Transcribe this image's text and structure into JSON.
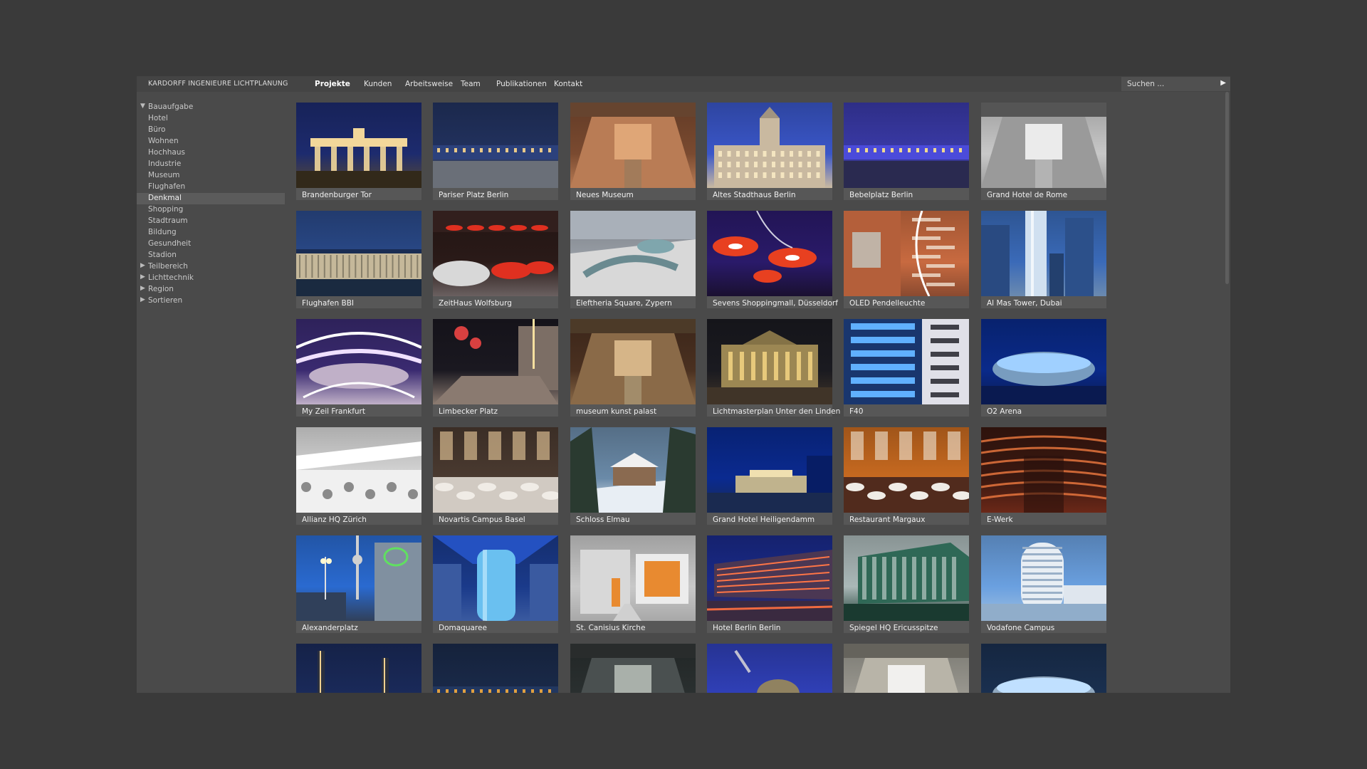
{
  "brand": "KARDORFF INGENIEURE LICHTPLANUNG",
  "nav": [
    "Projekte",
    "Kunden",
    "Arbeitsweise",
    "Team",
    "Publikationen",
    "Kontakt"
  ],
  "nav_active": "Projekte",
  "search": {
    "placeholder": "Suchen ...",
    "go": "▶"
  },
  "sidebar": [
    {
      "label": "Bauaufgabe",
      "tri": "▼",
      "sub": false,
      "sel": false
    },
    {
      "label": "Hotel",
      "tri": "",
      "sub": true,
      "sel": false
    },
    {
      "label": "Büro",
      "tri": "",
      "sub": true,
      "sel": false
    },
    {
      "label": "Wohnen",
      "tri": "",
      "sub": true,
      "sel": false
    },
    {
      "label": "Hochhaus",
      "tri": "",
      "sub": true,
      "sel": false
    },
    {
      "label": "Industrie",
      "tri": "",
      "sub": true,
      "sel": false
    },
    {
      "label": "Museum",
      "tri": "",
      "sub": true,
      "sel": false
    },
    {
      "label": "Flughafen",
      "tri": "",
      "sub": true,
      "sel": false
    },
    {
      "label": "Denkmal",
      "tri": "",
      "sub": true,
      "sel": true
    },
    {
      "label": "Shopping",
      "tri": "",
      "sub": true,
      "sel": false
    },
    {
      "label": "Stadtraum",
      "tri": "",
      "sub": true,
      "sel": false
    },
    {
      "label": "Bildung",
      "tri": "",
      "sub": true,
      "sel": false
    },
    {
      "label": "Gesundheit",
      "tri": "",
      "sub": true,
      "sel": false
    },
    {
      "label": "Stadion",
      "tri": "",
      "sub": true,
      "sel": false
    },
    {
      "label": "Teilbereich",
      "tri": "▶",
      "sub": false,
      "sel": false
    },
    {
      "label": "Lichttechnik",
      "tri": "▶",
      "sub": false,
      "sel": false
    },
    {
      "label": "Region",
      "tri": "▶",
      "sub": false,
      "sel": false
    },
    {
      "label": "Sortieren",
      "tri": "▶",
      "sub": false,
      "sel": false
    }
  ],
  "projects": [
    {
      "title": "Brandenburger Tor",
      "sky": "#1d2b6e",
      "ground": "#5a4a30",
      "accent": "#f2d79a",
      "kind": "gate"
    },
    {
      "title": "Pariser Platz Berlin",
      "sky": "#22325f",
      "ground": "#6a6f78",
      "accent": "#e8c888",
      "kind": "plaza"
    },
    {
      "title": "Neues Museum",
      "sky": "#7a4a30",
      "ground": "#b97c55",
      "accent": "#e8b080",
      "kind": "hall"
    },
    {
      "title": "Altes Stadthaus Berlin",
      "sky": "#3a56c8",
      "ground": "#c9b9a0",
      "accent": "#fff0c8",
      "kind": "tower"
    },
    {
      "title": "Bebelplatz Berlin",
      "sky": "#3a3aa8",
      "ground": "#2a2a50",
      "accent": "#f0d890",
      "kind": "plaza"
    },
    {
      "title": "Grand Hotel de Rome",
      "sky": "#c8c8c8",
      "ground": "#9a9a9a",
      "accent": "#ffffff",
      "kind": "hall"
    },
    {
      "title": "Flughafen BBI",
      "sky": "#2a4a8a",
      "ground": "#1a2a40",
      "accent": "#f6e6c0",
      "kind": "airport"
    },
    {
      "title": "ZeitHaus Wolfsburg",
      "sky": "#2a1a18",
      "ground": "#6a6060",
      "accent": "#e03020",
      "kind": "cars"
    },
    {
      "title": "Eleftheria Square, Zypern",
      "sky": "#9aa0a8",
      "ground": "#d8d8d8",
      "accent": "#6a8a90",
      "kind": "aerial"
    },
    {
      "title": "Sevens Shoppingmall, Düsseldorf",
      "sky": "#2a1a6a",
      "ground": "#1a1030",
      "accent": "#e84020",
      "kind": "lamps"
    },
    {
      "title": "OLED Pendelleuchte",
      "sky": "#c86a40",
      "ground": "#8a4a30",
      "accent": "#f0e0d0",
      "kind": "stairs"
    },
    {
      "title": "Al Mas Tower, Dubai",
      "sky": "#3a6ab8",
      "ground": "#6a8ab0",
      "accent": "#d0e0f0",
      "kind": "tower2"
    },
    {
      "title": "My Zeil Frankfurt",
      "sky": "#3a2a70",
      "ground": "#c0b0c8",
      "accent": "#f0e0ff",
      "kind": "mall"
    },
    {
      "title": "Limbecker Platz",
      "sky": "#1a1820",
      "ground": "#8a7a70",
      "accent": "#d84040",
      "kind": "street"
    },
    {
      "title": "museum kunst palast",
      "sky": "#4a3020",
      "ground": "#8a6a48",
      "accent": "#e8c898",
      "kind": "hall"
    },
    {
      "title": "Lichtmasterplan Unter den Linden",
      "sky": "#1a1a20",
      "ground": "#403428",
      "accent": "#f0d080",
      "kind": "opera"
    },
    {
      "title": "F40",
      "sky": "#2a5ab8",
      "ground": "#e0e0e8",
      "accent": "#60b0ff",
      "kind": "facade"
    },
    {
      "title": "O2 Arena",
      "sky": "#0a2a8a",
      "ground": "#0a1a50",
      "accent": "#a0d0ff",
      "kind": "arena"
    },
    {
      "title": "Allianz HQ Zürich",
      "sky": "#d8d8d8",
      "ground": "#f0f0f0",
      "accent": "#8a8a8a",
      "kind": "office"
    },
    {
      "title": "Novartis Campus Basel",
      "sky": "#4a3a30",
      "ground": "#e8e0d8",
      "accent": "#f0d0a0",
      "kind": "restaurant"
    },
    {
      "title": "Schloss Elmau",
      "sky": "#6a8aa8",
      "ground": "#e8eef4",
      "accent": "#8a6a50",
      "kind": "snow"
    },
    {
      "title": "Grand Hotel Heiligendamm",
      "sky": "#0a2a90",
      "ground": "#1a2a50",
      "accent": "#f0e0b0",
      "kind": "villa"
    },
    {
      "title": "Restaurant Margaux",
      "sky": "#c86a20",
      "ground": "#5a3020",
      "accent": "#f0e8d8",
      "kind": "restaurant"
    },
    {
      "title": "E-Werk",
      "sky": "#3a1810",
      "ground": "#6a2818",
      "accent": "#f07a40",
      "kind": "ewerk"
    },
    {
      "title": "Alexanderplatz",
      "sky": "#2a6ad0",
      "ground": "#30405a",
      "accent": "#60e060",
      "kind": "tv"
    },
    {
      "title": "Domaquaree",
      "sky": "#1a3a8a",
      "ground": "#3a5aa0",
      "accent": "#6ac0f0",
      "kind": "aqua"
    },
    {
      "title": "St. Canisius Kirche",
      "sky": "#c8c8c8",
      "ground": "#a8a8a8",
      "accent": "#e88a30",
      "kind": "church"
    },
    {
      "title": "Hotel Berlin Berlin",
      "sky": "#1a2a8a",
      "ground": "#3a2a40",
      "accent": "#f06a40",
      "kind": "hotel"
    },
    {
      "title": "Spiegel HQ Ericusspitze",
      "sky": "#aab8b8",
      "ground": "#1a3a30",
      "accent": "#f0f0f0",
      "kind": "glass"
    },
    {
      "title": "Vodafone Campus",
      "sky": "#6aa0e0",
      "ground": "#a0c0e0",
      "accent": "#ffffff",
      "kind": "round"
    },
    {
      "title": "",
      "sky": "#1a2a5a",
      "ground": "#0a1020",
      "accent": "#f0d090",
      "kind": "towers"
    },
    {
      "title": "",
      "sky": "#1a2a4a",
      "ground": "#3a3a40",
      "accent": "#e0a040",
      "kind": "plaza"
    },
    {
      "title": "",
      "sky": "#2a3030",
      "ground": "#4a5050",
      "accent": "#c0c8c0",
      "kind": "hall"
    },
    {
      "title": "",
      "sky": "#3040b8",
      "ground": "#2a2a60",
      "accent": "#f0d8a0",
      "kind": "dome"
    },
    {
      "title": "",
      "sky": "#9a9890",
      "ground": "#b8b4a8",
      "accent": "#ffffff",
      "kind": "hall"
    },
    {
      "title": "",
      "sky": "#1a3050",
      "ground": "#4a6080",
      "accent": "#c0e0ff",
      "kind": "arena"
    }
  ]
}
